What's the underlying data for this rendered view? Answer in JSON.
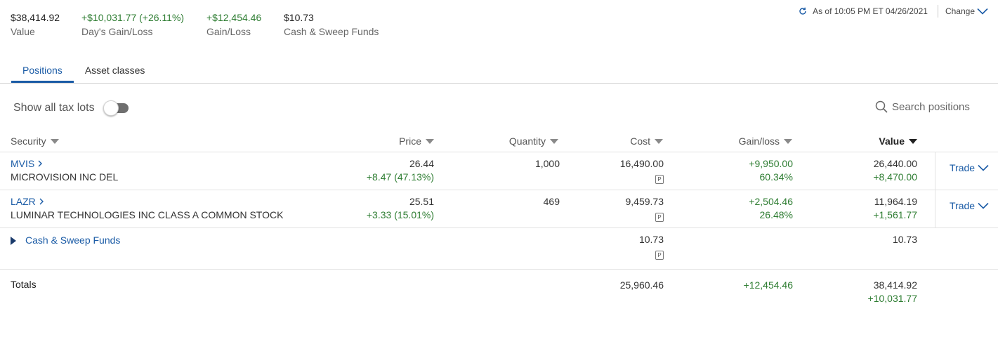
{
  "summary": {
    "value": {
      "amount": "$38,414.92",
      "label": "Value"
    },
    "days_gain": {
      "amount": "+$10,031.77 (+26.11%)",
      "label": "Day's Gain/Loss"
    },
    "gain_loss": {
      "amount": "+$12,454.46",
      "label": "Gain/Loss"
    },
    "cash": {
      "amount": "$10.73",
      "label": "Cash & Sweep Funds"
    }
  },
  "as_of": {
    "text": "As of 10:05 PM ET 04/26/2021",
    "change_label": "Change"
  },
  "tabs": [
    {
      "label": "Positions",
      "active": true
    },
    {
      "label": "Asset classes",
      "active": false
    }
  ],
  "tax_lots": {
    "label": "Show all tax lots",
    "on": false
  },
  "search": {
    "placeholder": "Search positions"
  },
  "columns": [
    "Security",
    "Price",
    "Quantity",
    "Cost",
    "Gain/loss",
    "Value"
  ],
  "rows": [
    {
      "symbol": "MVIS",
      "name": "MICROVISION INC DEL",
      "price": "26.44",
      "price_change": "+8.47 (47.13%)",
      "quantity": "1,000",
      "cost": "16,490.00",
      "cost_badge": "P",
      "gain": "+9,950.00",
      "gain_pct": "60.34%",
      "value": "26,440.00",
      "value_change": "+8,470.00",
      "action": "Trade"
    },
    {
      "symbol": "LAZR",
      "name": "LUMINAR TECHNOLOGIES INC CLASS A COMMON STOCK",
      "price": "25.51",
      "price_change": "+3.33 (15.01%)",
      "quantity": "469",
      "cost": "9,459.73",
      "cost_badge": "P",
      "gain": "+2,504.46",
      "gain_pct": "26.48%",
      "value": "11,964.19",
      "value_change": "+1,561.77",
      "action": "Trade"
    }
  ],
  "cash_row": {
    "label": "Cash & Sweep Funds",
    "cost": "10.73",
    "cost_badge": "P",
    "value": "10.73"
  },
  "totals": {
    "label": "Totals",
    "cost": "25,960.46",
    "gain": "+12,454.46",
    "value": "38,414.92",
    "value_change": "+10,031.77"
  },
  "colors": {
    "link": "#1a5ba6",
    "gain": "#2e7d32",
    "text": "#333333",
    "rule": "#e3e3e3"
  },
  "icons": [
    "refresh-icon",
    "chevron-down-icon",
    "search-icon",
    "sort-triangle-icon",
    "chevron-right-icon",
    "caret-right-icon"
  ]
}
